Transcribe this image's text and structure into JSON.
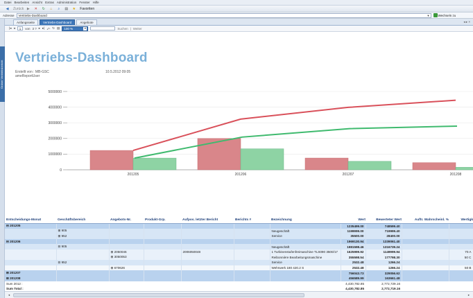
{
  "menu": [
    "Datei",
    "Bearbeiten",
    "Ansicht",
    "Extras",
    "Administration",
    "Fenster",
    "Hilfe"
  ],
  "toolbar": {
    "back_label": "Zurück",
    "forward_label": "Vorwärts",
    "favorites_label": "Favoriten"
  },
  "address": {
    "label": "Adresse",
    "value": "Vertriebs-Dashboard",
    "right_label": "Wechseln zu"
  },
  "left_strip_label": "Ordner Vertriebsbericht",
  "tabs": [
    "Anfangsseite",
    "Vertriebs-Dashboard",
    "Angebote"
  ],
  "tabs_right": "◂ ▸ ×",
  "viewer": {
    "page_label": "von",
    "page_current": "1",
    "page_total": "3 ?",
    "zoom": "100 %",
    "find_label": "Suchen",
    "next_label": "Weiter"
  },
  "report": {
    "title": "Vertriebs-Dashboard",
    "created_by": "Erstellt von : MB-GSC",
    "created_by_2": "ameReportUser",
    "date": "10.5.2012 09:05"
  },
  "colors": {
    "bar_red": "#d9868a",
    "bar_green": "#8ed3a4",
    "line_red": "#d9505a",
    "line_green": "#3fba6e",
    "header": "#1d3f7a",
    "title": "#7ab0d9"
  },
  "chart_data": {
    "type": "bar",
    "categories": [
      "201205",
      "201206",
      "201207",
      "201208"
    ],
    "ylim": [
      0,
      5000000
    ],
    "yticks": [
      "0",
      "1000000",
      "2000000",
      "3000000",
      "4000000",
      "5000000"
    ],
    "series": [
      {
        "type": "bar",
        "color": "#d9868a",
        "values": [
          1235000,
          2001000,
          750000,
          456000
        ]
      },
      {
        "type": "bar",
        "color": "#8ed3a4",
        "values": [
          748000,
          1340000,
          540000,
          160000
        ]
      },
      {
        "type": "line",
        "color": "#d9505a",
        "values": [
          1235000,
          3236000,
          3986000,
          4442000
        ]
      },
      {
        "type": "line",
        "color": "#3fba6e",
        "values": [
          748000,
          2088000,
          2628000,
          2788000
        ]
      }
    ]
  },
  "table": {
    "headers": [
      "Entscheidungs-Monat",
      "Geschäftsbereich",
      "Angebots-Nr.",
      "Produkt-Grp.",
      "Aufpos. letzter Bericht",
      "Berichts #",
      "Bezeichnung",
      "Wert",
      "Bewerteter Wert",
      "Auftr. Wahrscheinl. %",
      "Wertigk"
    ],
    "rows": [
      {
        "lvl": "l1",
        "c": [
          "⊟      201205",
          "",
          "",
          "",
          "",
          "",
          "",
          "1235499.00",
          "748599.40",
          "",
          ""
        ]
      },
      {
        "lvl": "l2",
        "c": [
          "",
          "⊞ 905",
          "",
          "",
          "",
          "",
          "Neugeschäft",
          "1199999.00",
          "719999.40",
          "",
          ""
        ]
      },
      {
        "lvl": "l2",
        "c": [
          "",
          "⊞ 952",
          "",
          "",
          "",
          "",
          "Service",
          "35500.00",
          "28400.00",
          "",
          ""
        ]
      },
      {
        "lvl": "l1",
        "c": [
          "⊟      201206",
          "",
          "",
          "",
          "",
          "",
          "",
          "1969130.94",
          "1339061.40",
          "",
          ""
        ]
      },
      {
        "lvl": "l2",
        "c": [
          "",
          "⊟ 905",
          "",
          "",
          "",
          "",
          "Neugeschäft",
          "1981598.46",
          "1316739.24",
          "",
          ""
        ]
      },
      {
        "lvl": "l3",
        "c": [
          "",
          "",
          "⊞ 2050046",
          "",
          "2006050048",
          "",
          "1 Turbinenstufenfreimaschine TLS090 3500/17",
          "1625999.92",
          "1149999.94",
          "",
          "70 A"
        ]
      },
      {
        "lvl": "l3",
        "c": [
          "",
          "",
          "⊞ 3050053",
          "",
          "",
          "",
          "Reibonnière Bearbeitungsmaschine",
          "355598.54",
          "177798.30",
          "",
          "50 C"
        ]
      },
      {
        "lvl": "l2",
        "c": [
          "",
          "⊟ 952",
          "",
          "",
          "",
          "",
          "Service",
          "2532.48",
          "1266.24",
          "",
          ""
        ]
      },
      {
        "lvl": "l4",
        "c": [
          "",
          "",
          "⊞ 670626",
          "",
          "",
          "",
          "Wehrwerk 180 420.2 S",
          "2532.48",
          "1266.24",
          "",
          "50 B"
        ]
      },
      {
        "lvl": "l1",
        "c": [
          "⊞      201207",
          "",
          "",
          "",
          "",
          "",
          "",
          "756043.73",
          "329056.62",
          "",
          ""
        ]
      },
      {
        "lvl": "l1",
        "c": [
          "⊞      201208",
          "",
          "",
          "",
          "",
          "",
          "",
          "456589.99",
          "163661.48",
          "",
          ""
        ]
      },
      {
        "lvl": "sum2",
        "c": [
          "Sum 2012 :",
          "",
          "",
          "",
          "",
          "",
          "",
          "4,430,782.85",
          "2,772,729.16",
          "",
          ""
        ]
      },
      {
        "lvl": "sum",
        "c": [
          "Sum Total :",
          "",
          "",
          "",
          "",
          "",
          "",
          "4,430,782.85",
          "2,772,719.16",
          "",
          ""
        ]
      }
    ]
  }
}
